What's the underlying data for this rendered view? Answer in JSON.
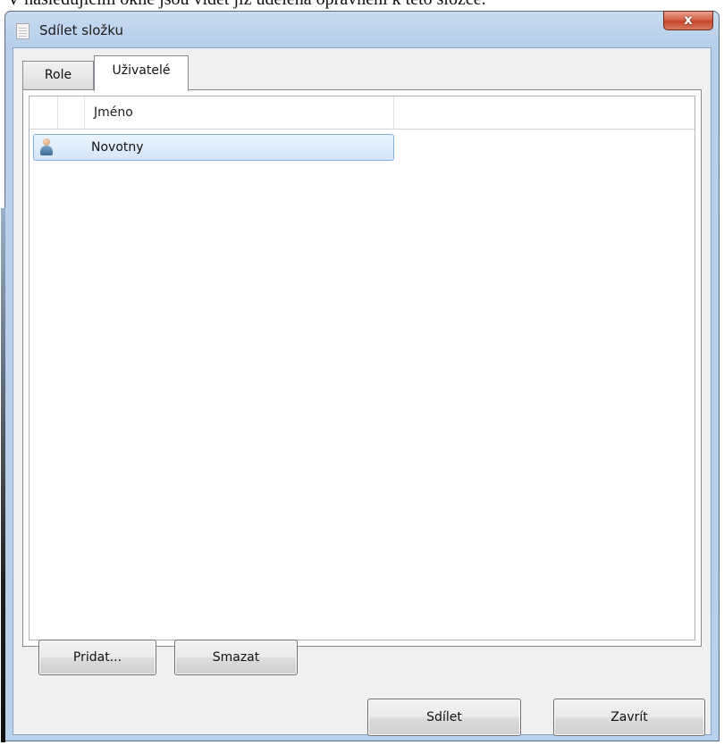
{
  "page_caption": "V následujícím okně jsou vidět již udělená oprávnění k této složce.",
  "window": {
    "title": "Sdílet složku",
    "close_label": "x"
  },
  "tabs": [
    {
      "label": "Role",
      "selected": false
    },
    {
      "label": "Uživatelé",
      "selected": true
    }
  ],
  "users_list": {
    "columns": [
      "",
      "",
      "Jméno"
    ],
    "rows": [
      {
        "icon": "user-icon",
        "name": "Novotny",
        "selected": true
      }
    ]
  },
  "buttons": {
    "add": "Pridat...",
    "delete": "Smazat",
    "share": "Sdílet",
    "close": "Zavrít"
  }
}
